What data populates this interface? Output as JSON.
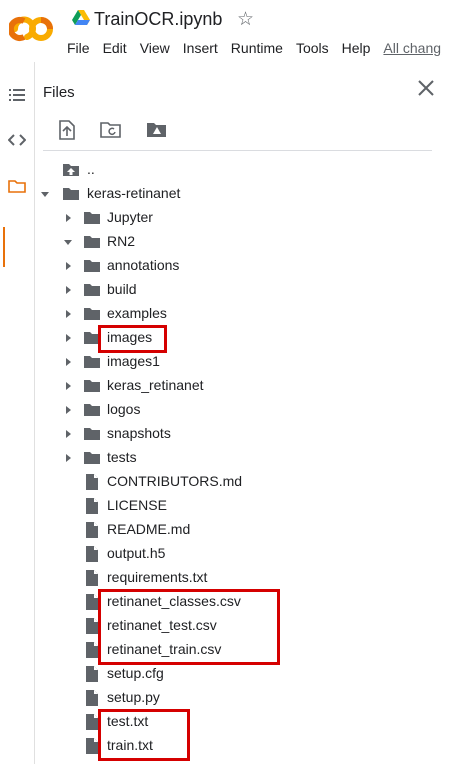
{
  "header": {
    "title": "TrainOCR.ipynb",
    "logo_text": "CO",
    "menu": [
      "File",
      "Edit",
      "View",
      "Insert",
      "Runtime",
      "Tools",
      "Help"
    ],
    "all_changes": "All chang"
  },
  "files_panel": {
    "title": "Files"
  },
  "tree": [
    {
      "label": "..",
      "kind": "up",
      "depth": 0,
      "arrow": "none"
    },
    {
      "label": "keras-retinanet",
      "kind": "folder",
      "depth": 0,
      "arrow": "open"
    },
    {
      "label": "Jupyter",
      "kind": "folder",
      "depth": 1,
      "arrow": "closed"
    },
    {
      "label": "RN2",
      "kind": "folder",
      "depth": 1,
      "arrow": "open"
    },
    {
      "label": "annotations",
      "kind": "folder",
      "depth": 2,
      "arrow": "closed"
    },
    {
      "label": "build",
      "kind": "folder",
      "depth": 2,
      "arrow": "closed"
    },
    {
      "label": "examples",
      "kind": "folder",
      "depth": 2,
      "arrow": "closed"
    },
    {
      "label": "images",
      "kind": "folder",
      "depth": 2,
      "arrow": "closed",
      "highlight": true
    },
    {
      "label": "images1",
      "kind": "folder",
      "depth": 2,
      "arrow": "closed"
    },
    {
      "label": "keras_retinanet",
      "kind": "folder",
      "depth": 2,
      "arrow": "closed"
    },
    {
      "label": "logos",
      "kind": "folder",
      "depth": 2,
      "arrow": "closed"
    },
    {
      "label": "snapshots",
      "kind": "folder",
      "depth": 2,
      "arrow": "closed"
    },
    {
      "label": "tests",
      "kind": "folder",
      "depth": 2,
      "arrow": "closed"
    },
    {
      "label": "CONTRIBUTORS.md",
      "kind": "file",
      "depth": 2,
      "arrow": "none"
    },
    {
      "label": "LICENSE",
      "kind": "file",
      "depth": 2,
      "arrow": "none"
    },
    {
      "label": "README.md",
      "kind": "file",
      "depth": 2,
      "arrow": "none"
    },
    {
      "label": "output.h5",
      "kind": "file",
      "depth": 2,
      "arrow": "none"
    },
    {
      "label": "requirements.txt",
      "kind": "file",
      "depth": 2,
      "arrow": "none"
    },
    {
      "label": "retinanet_classes.csv",
      "kind": "file",
      "depth": 2,
      "arrow": "none",
      "highlight": true
    },
    {
      "label": "retinanet_test.csv",
      "kind": "file",
      "depth": 2,
      "arrow": "none",
      "highlight": true
    },
    {
      "label": "retinanet_train.csv",
      "kind": "file",
      "depth": 2,
      "arrow": "none",
      "highlight": true
    },
    {
      "label": "setup.cfg",
      "kind": "file",
      "depth": 2,
      "arrow": "none"
    },
    {
      "label": "setup.py",
      "kind": "file",
      "depth": 2,
      "arrow": "none"
    },
    {
      "label": "test.txt",
      "kind": "file",
      "depth": 2,
      "arrow": "none",
      "highlight": true
    },
    {
      "label": "train.txt",
      "kind": "file",
      "depth": 2,
      "arrow": "none",
      "highlight": true
    }
  ],
  "colors": {
    "logo_orange": "#f9ab00",
    "logo_dark_orange": "#e8710a",
    "icon_gray": "#5f6368",
    "highlight_red": "#d50000"
  }
}
